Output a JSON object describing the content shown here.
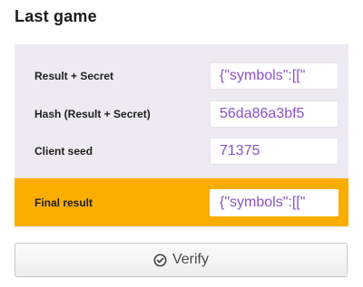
{
  "section_title": "Last game",
  "rows": [
    {
      "label": "Result + Secret",
      "value": "{\"symbols\":[[\""
    },
    {
      "label": "Hash (Result + Secret)",
      "value": "56da86a3bf5"
    },
    {
      "label": "Client seed",
      "value": "71375"
    }
  ],
  "final": {
    "label": "Final result",
    "value": "{\"symbols\":[[\""
  },
  "verify_button": {
    "label": "Verify",
    "icon": "check-circle-icon"
  },
  "colors": {
    "panel_bg": "#edeaf3",
    "final_bg": "#fbae00",
    "value_text": "#8a52c9"
  }
}
